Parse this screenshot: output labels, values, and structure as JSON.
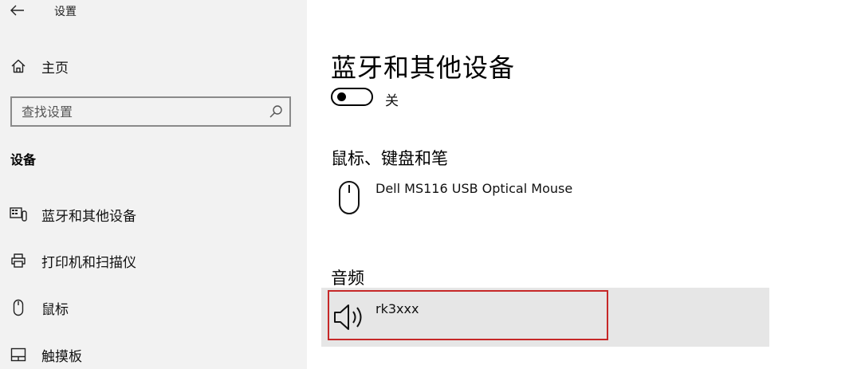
{
  "window": {
    "title": "设置",
    "back_icon": "back-arrow-icon"
  },
  "sidebar": {
    "home": {
      "label": "主页",
      "icon": "home-icon"
    },
    "search": {
      "placeholder": "查找设置",
      "icon": "search-icon"
    },
    "section": "设备",
    "items": [
      {
        "label": "蓝牙和其他设备",
        "icon": "bluetooth-devices-icon"
      },
      {
        "label": "打印机和扫描仪",
        "icon": "printer-icon"
      },
      {
        "label": "鼠标",
        "icon": "mouse-icon"
      },
      {
        "label": "触摸板",
        "icon": "touchpad-icon"
      }
    ]
  },
  "main": {
    "title": "蓝牙和其他设备",
    "bluetooth_toggle": {
      "state_label": "关",
      "on": false
    },
    "groups": {
      "mouse_keyboard_pen": {
        "heading": "鼠标、键盘和笔",
        "devices": [
          {
            "name": "Dell MS116 USB Optical Mouse",
            "icon": "mouse-icon"
          }
        ]
      },
      "audio": {
        "heading": "音频",
        "devices": [
          {
            "name": "rk3xxx",
            "icon": "speaker-icon",
            "highlighted": true
          }
        ]
      }
    }
  },
  "colors": {
    "sidebar_bg": "#f2f2f2",
    "selected_row_bg": "#e6e6e6",
    "highlight_border": "#c62828"
  }
}
